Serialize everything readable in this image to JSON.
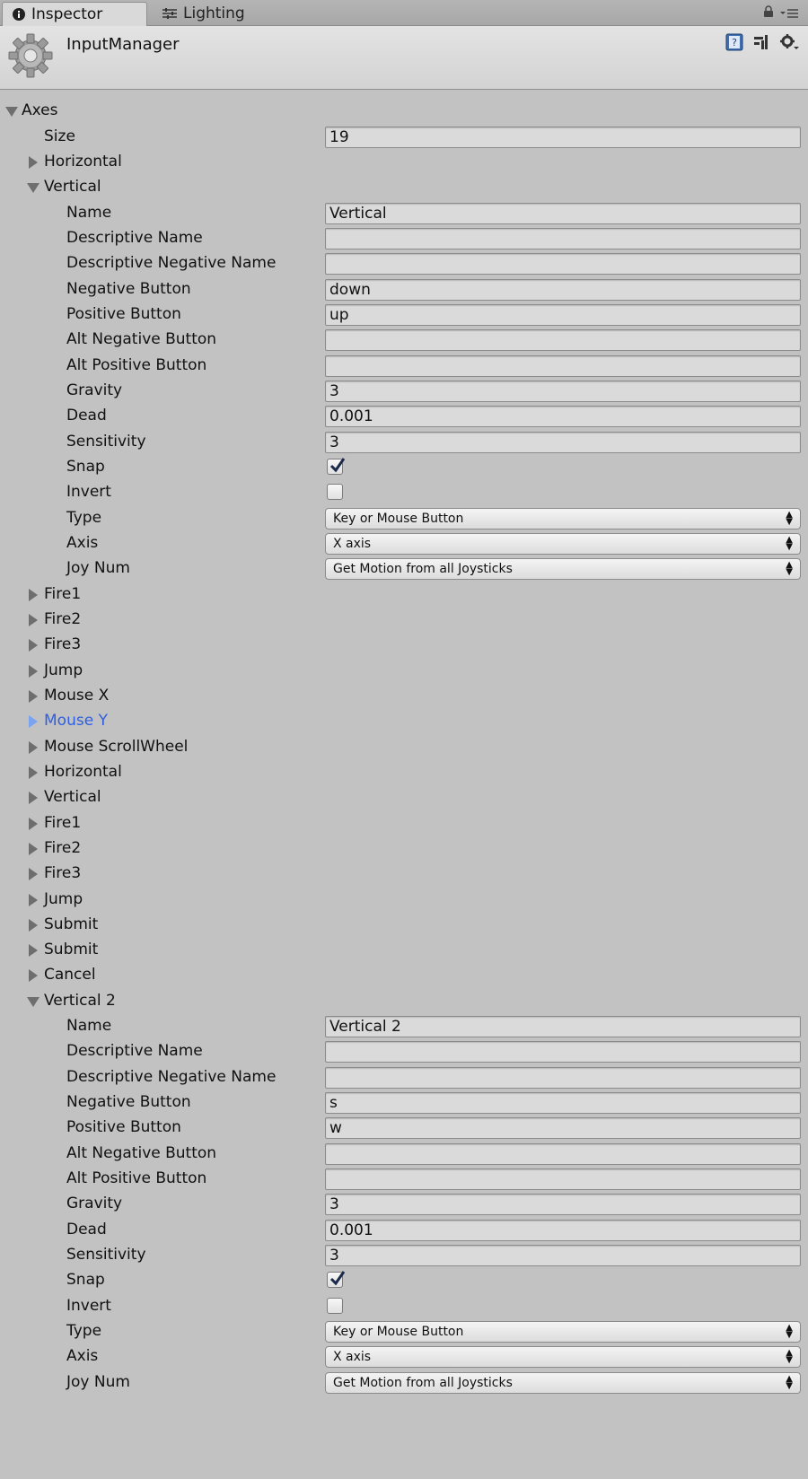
{
  "tabs": {
    "inspector": "Inspector",
    "lighting": "Lighting"
  },
  "header": {
    "title": "InputManager"
  },
  "axes": {
    "label": "Axes",
    "size_label": "Size",
    "size_value": "19",
    "items": [
      "Horizontal",
      "Vertical",
      "Fire1",
      "Fire2",
      "Fire3",
      "Jump",
      "Mouse X",
      "Mouse Y",
      "Mouse ScrollWheel",
      "Horizontal",
      "Vertical",
      "Fire1",
      "Fire2",
      "Fire3",
      "Jump",
      "Submit",
      "Submit",
      "Cancel",
      "Vertical 2"
    ]
  },
  "labels": {
    "name": "Name",
    "descriptive_name": "Descriptive Name",
    "descriptive_negative_name": "Descriptive Negative Name",
    "negative_button": "Negative Button",
    "positive_button": "Positive Button",
    "alt_negative_button": "Alt Negative Button",
    "alt_positive_button": "Alt Positive Button",
    "gravity": "Gravity",
    "dead": "Dead",
    "sensitivity": "Sensitivity",
    "snap": "Snap",
    "invert": "Invert",
    "type": "Type",
    "axis": "Axis",
    "joy_num": "Joy Num"
  },
  "vertical": {
    "name": "Vertical",
    "descriptive_name": "",
    "descriptive_negative_name": "",
    "negative_button": "down",
    "positive_button": "up",
    "alt_negative_button": "",
    "alt_positive_button": "",
    "gravity": "3",
    "dead": "0.001",
    "sensitivity": "3",
    "snap": true,
    "invert": false,
    "type": "Key or Mouse Button",
    "axis": "X axis",
    "joy_num": "Get Motion from all Joysticks"
  },
  "vertical2": {
    "name": "Vertical 2",
    "descriptive_name": "",
    "descriptive_negative_name": "",
    "negative_button": "s",
    "positive_button": "w",
    "alt_negative_button": "",
    "alt_positive_button": "",
    "gravity": "3",
    "dead": "0.001",
    "sensitivity": "3",
    "snap": true,
    "invert": false,
    "type": "Key or Mouse Button",
    "axis": "X axis",
    "joy_num": "Get Motion from all Joysticks"
  },
  "colors": {
    "selected_item": "#2f5fe0",
    "background": "#c2c2c2"
  }
}
